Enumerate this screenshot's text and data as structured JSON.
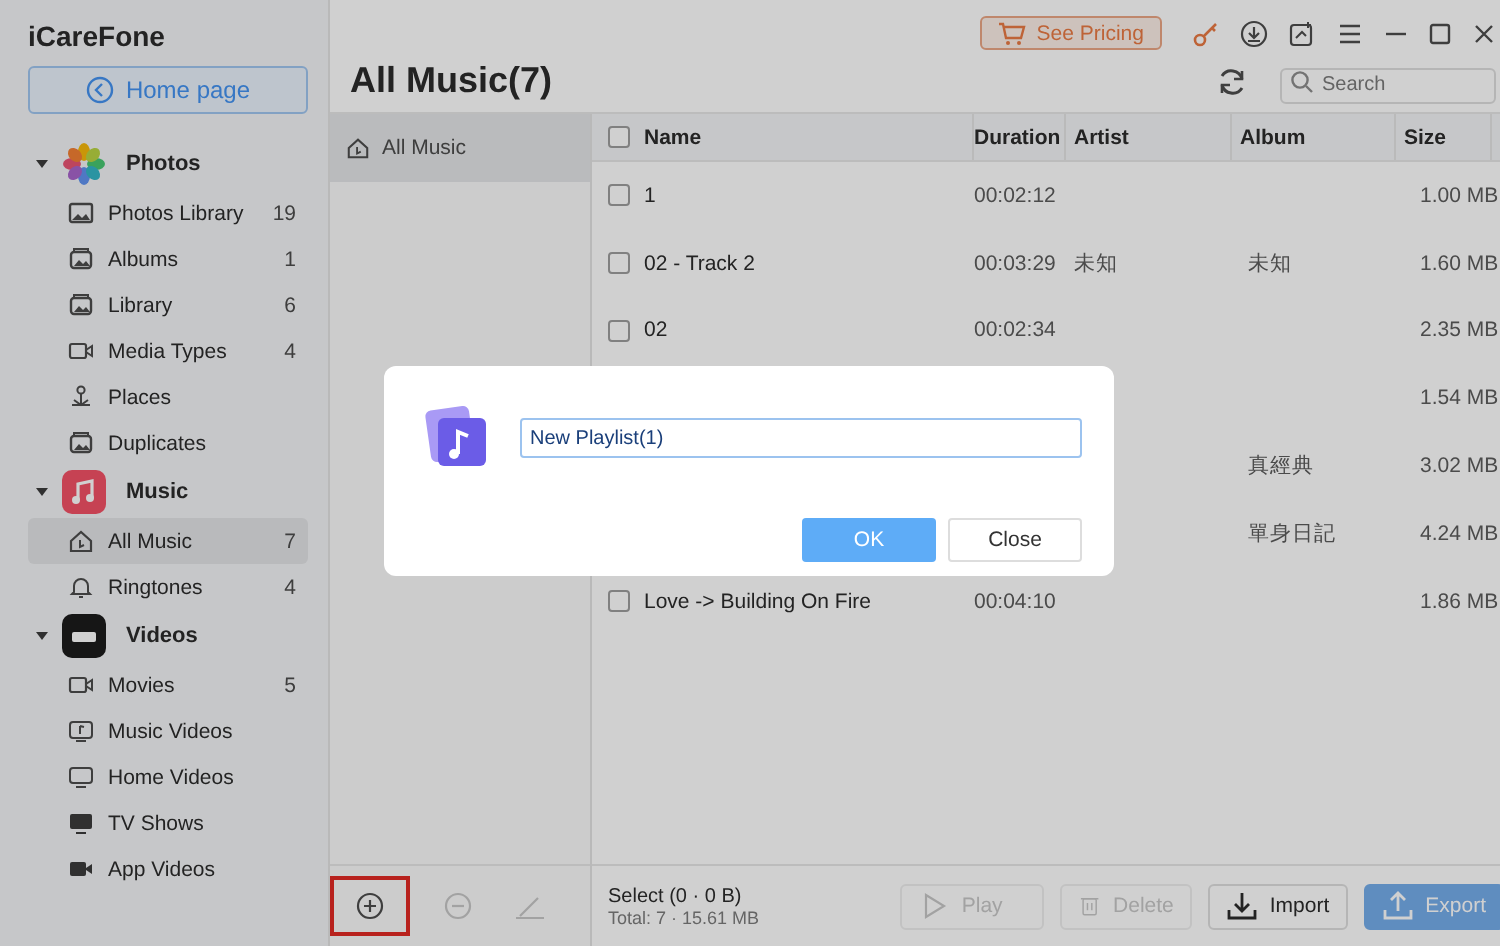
{
  "app": {
    "title": "iCareFone"
  },
  "home_button": "Home page",
  "sidebar": [
    {
      "label": "Photos",
      "kind": "photos",
      "expanded": true,
      "children": [
        {
          "label": "Photos Library",
          "count": "19",
          "kind": "image",
          "selected": false
        },
        {
          "label": "Albums",
          "count": "1",
          "kind": "album",
          "selected": false
        },
        {
          "label": "Library",
          "count": "6",
          "kind": "album",
          "selected": false
        },
        {
          "label": "Media Types",
          "count": "4",
          "kind": "video",
          "selected": false
        },
        {
          "label": "Places",
          "kind": "pin",
          "selected": false
        },
        {
          "label": "Duplicates",
          "kind": "album",
          "selected": false
        }
      ]
    },
    {
      "label": "Music",
      "kind": "music",
      "expanded": true,
      "children": [
        {
          "label": "All Music",
          "count": "7",
          "kind": "home",
          "selected": true
        },
        {
          "label": "Ringtones",
          "count": "4",
          "kind": "bell",
          "selected": false
        }
      ]
    },
    {
      "label": "Videos",
      "kind": "tv",
      "expanded": true,
      "children": [
        {
          "label": "Movies",
          "count": "5",
          "kind": "video",
          "selected": false
        },
        {
          "label": "Music Videos",
          "kind": "musicvideo",
          "selected": false
        },
        {
          "label": "Home Videos",
          "kind": "monitor",
          "selected": false
        },
        {
          "label": "TV Shows",
          "kind": "tvshow",
          "selected": false
        },
        {
          "label": "App Videos",
          "kind": "camera",
          "selected": false
        }
      ]
    }
  ],
  "pricing_button": "See Pricing",
  "page_title": "All Music(7)",
  "search": {
    "placeholder": "Search"
  },
  "playlists": [
    {
      "label": "All Music",
      "selected": true
    }
  ],
  "playlist_tools": [
    {
      "kind": "add",
      "disabled": false,
      "highlighted": true
    },
    {
      "kind": "remove",
      "disabled": true,
      "highlighted": false
    },
    {
      "kind": "edit",
      "disabled": true,
      "highlighted": false
    }
  ],
  "table": {
    "select_all_checked": false,
    "columns": [
      "Name",
      "Duration",
      "Artist",
      "Album",
      "Size"
    ],
    "rows": [
      {
        "checked": false,
        "name": "1",
        "duration": "00:02:12",
        "size": "1.00 MB"
      },
      {
        "checked": false,
        "name": "02 - Track  2",
        "duration": "00:03:29",
        "artist": "未知",
        "album": "未知",
        "size": "1.60 MB"
      },
      {
        "checked": false,
        "name": "02",
        "duration": "00:02:34",
        "size": "2.35 MB"
      },
      {
        "size": "1.54 MB"
      },
      {
        "album": "真經典",
        "size": "3.02 MB"
      },
      {
        "album": "單身日記",
        "size": "4.24 MB"
      },
      {
        "checked": false,
        "name": "Love -> Building On Fire",
        "duration": "00:04:10",
        "size": "1.86 MB"
      }
    ]
  },
  "footer": {
    "selection": "Select (0 · 0 B)",
    "total": "Total: 7 · 15.61 MB",
    "buttons": [
      {
        "label": "Play",
        "kind": "play",
        "disabled": true
      },
      {
        "label": "Delete",
        "kind": "delete",
        "disabled": true
      },
      {
        "label": "Import",
        "kind": "import",
        "disabled": false
      },
      {
        "label": "Export",
        "kind": "export",
        "disabled": true
      }
    ]
  },
  "dialog": {
    "value": "New Playlist(1)",
    "ok": "OK",
    "close": "Close"
  }
}
